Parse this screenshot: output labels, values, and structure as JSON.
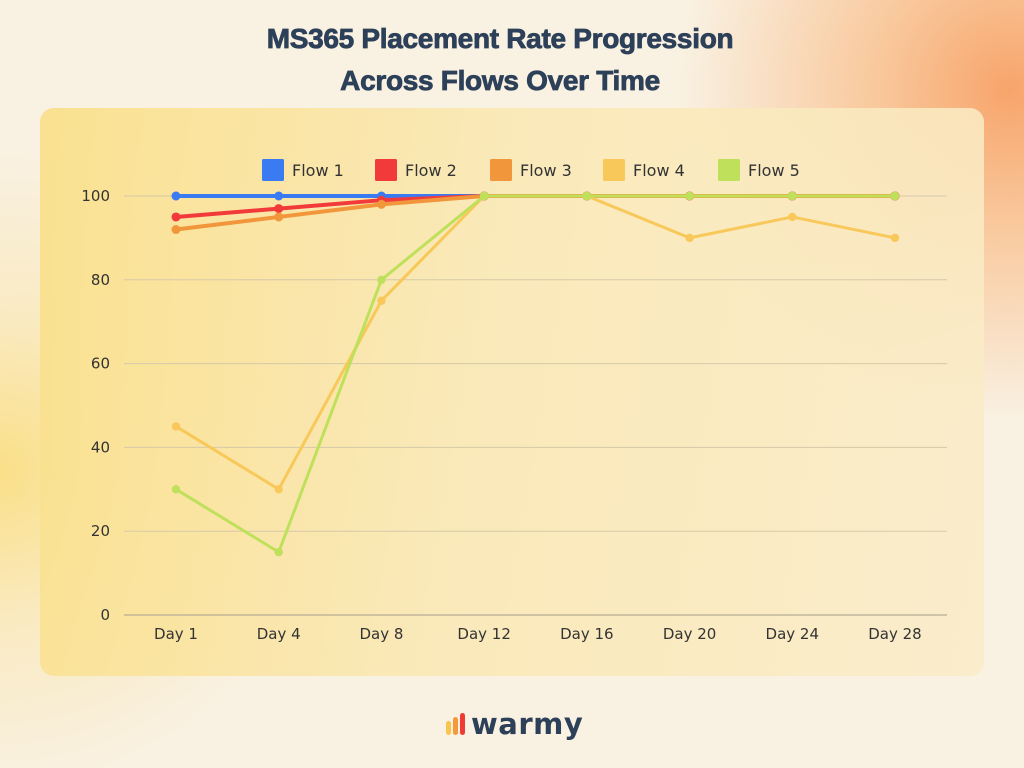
{
  "title_lines": [
    "MS365 Placement Rate Progression",
    "Across Flows Over Time"
  ],
  "brand": {
    "name": "warmy",
    "icon": "bar-chart-logo-icon",
    "bar_colors": [
      "#fbc54d",
      "#f59a3a",
      "#f03a35"
    ]
  },
  "chart_data": {
    "type": "line",
    "title": "MS365 Placement Rate Progression Across Flows Over Time",
    "xlabel": "",
    "ylabel": "",
    "categories": [
      "Day 1",
      "Day 4",
      "Day 8",
      "Day 12",
      "Day 16",
      "Day 20",
      "Day 24",
      "Day 28"
    ],
    "ylim": [
      0,
      100
    ],
    "yticks": [
      0,
      20,
      40,
      60,
      80,
      100
    ],
    "grid": true,
    "legend_position": "top-center",
    "series": [
      {
        "name": "Flow 1",
        "color": "#3b7bf2",
        "values": [
          100,
          100,
          100,
          100,
          100,
          100,
          100,
          100
        ]
      },
      {
        "name": "Flow 2",
        "color": "#f23a3a",
        "values": [
          95,
          97,
          99,
          100,
          100,
          100,
          100,
          100
        ]
      },
      {
        "name": "Flow 3",
        "color": "#f2963c",
        "values": [
          92,
          95,
          98,
          100,
          100,
          100,
          100,
          100
        ]
      },
      {
        "name": "Flow 4",
        "color": "#f8c85a",
        "values": [
          45,
          30,
          75,
          100,
          100,
          90,
          95,
          90
        ]
      },
      {
        "name": "Flow 5",
        "color": "#bfe05a",
        "values": [
          30,
          15,
          80,
          100,
          100,
          100,
          100,
          100
        ]
      }
    ]
  }
}
